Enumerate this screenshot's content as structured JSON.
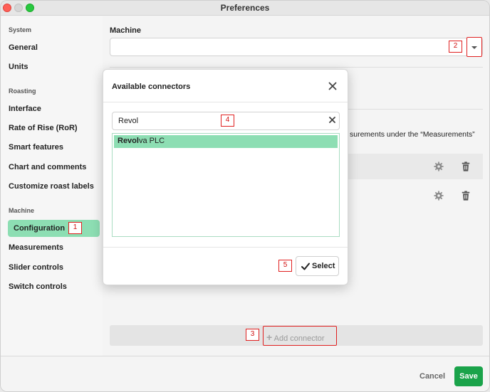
{
  "window": {
    "title": "Preferences"
  },
  "sidebar": {
    "sections": [
      {
        "label": "System"
      },
      {
        "label": "Roasting"
      },
      {
        "label": "Machine"
      }
    ],
    "items": [
      {
        "label": "General"
      },
      {
        "label": "Units"
      },
      {
        "label": "Interface"
      },
      {
        "label": "Rate of Rise (RoR)"
      },
      {
        "label": "Smart features"
      },
      {
        "label": "Chart and comments"
      },
      {
        "label": "Customize roast labels"
      },
      {
        "label": "Configuration"
      },
      {
        "label": "Measurements"
      },
      {
        "label": "Slider controls"
      },
      {
        "label": "Switch controls"
      }
    ],
    "active_item": "Configuration"
  },
  "main": {
    "machine_label": "Machine",
    "machine_value": "",
    "info_text_fragment": "surements under the “Measurements”",
    "add_connector_label": "Add connector"
  },
  "modal": {
    "title": "Available connectors",
    "search_value": "Revol",
    "results": [
      {
        "match": "Revol",
        "rest": "va PLC"
      }
    ],
    "select_label": "Select"
  },
  "footer": {
    "cancel_label": "Cancel",
    "save_label": "Save"
  },
  "markers": [
    "1",
    "2",
    "3",
    "4",
    "5"
  ],
  "colors": {
    "accent_active": "#8ddeb3",
    "save_green": "#1aa34a",
    "marker_red": "#e02020"
  },
  "icons": [
    "close-icon",
    "clear-icon",
    "check-icon",
    "gear-icon",
    "trash-icon",
    "chevron-down-icon",
    "plus-icon"
  ]
}
